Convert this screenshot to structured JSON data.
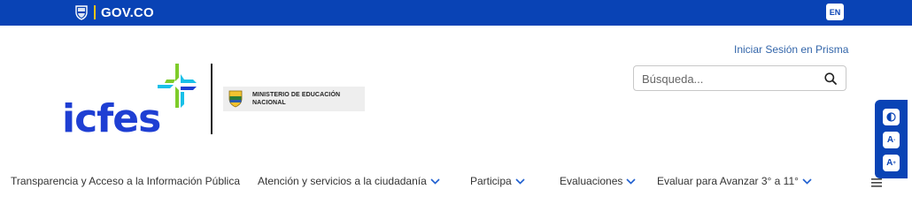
{
  "gov_bar": {
    "brand_text": "GOV.CO",
    "lang_label": "EN",
    "bar_color": "#0943b5",
    "accent_color": "#f5c518"
  },
  "header": {
    "login_link": "Iniciar Sesión en Prisma",
    "search": {
      "placeholder": "Búsqueda...",
      "icon": "search-icon"
    },
    "logo": {
      "name": "icfes",
      "icon": "icfes-logo-icon",
      "brand_blue": "#1f3fd3",
      "brand_green": "#7fcc2a",
      "brand_cyan": "#19c0e8"
    },
    "ministry_line1": "MINISTERIO DE EDUCACIÓN",
    "ministry_line2": "NACIONAL"
  },
  "accessibility": {
    "buttons": [
      {
        "name": "contrast",
        "icon": "contrast-icon"
      },
      {
        "name": "decrease-font",
        "label": "A",
        "sup": "-"
      },
      {
        "name": "increase-font",
        "label": "A",
        "sup": "+"
      }
    ]
  },
  "nav": {
    "items": [
      {
        "label": "Transparencia y Acceso a la Información Pública",
        "has_dropdown": false
      },
      {
        "label": "Atención y servicios a la ciudadanía",
        "has_dropdown": true
      },
      {
        "label": "Participa",
        "has_dropdown": true
      },
      {
        "label": "Evaluaciones",
        "has_dropdown": true
      },
      {
        "label": "Evaluar para Avanzar 3° a 11°",
        "has_dropdown": true
      }
    ],
    "menu_icon": "hamburger-menu-icon"
  }
}
